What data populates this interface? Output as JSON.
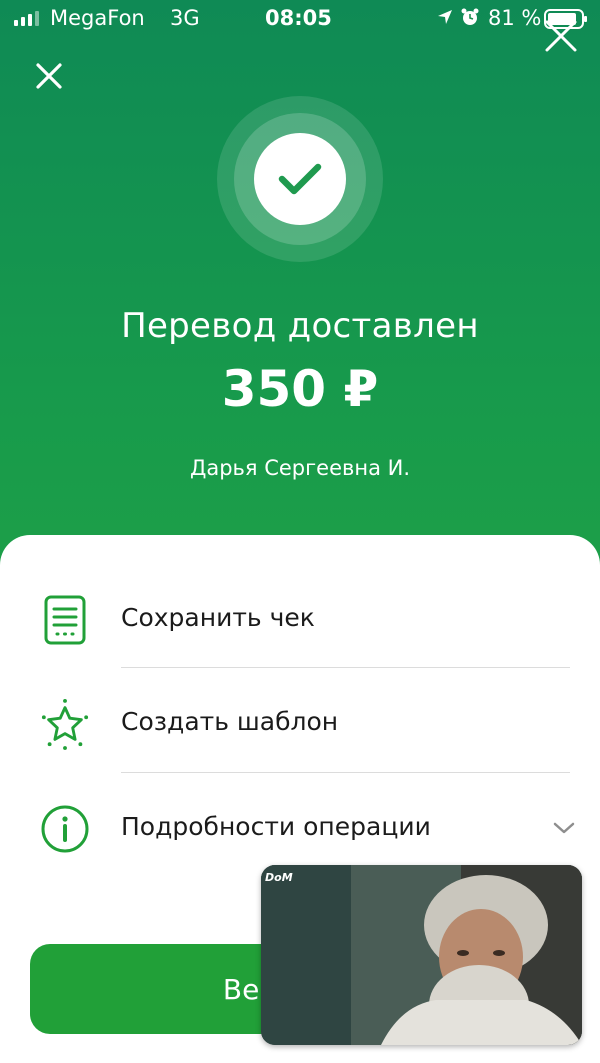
{
  "status_bar": {
    "carrier": "MegaFon",
    "network": "3G",
    "time": "08:05",
    "battery": "81 %"
  },
  "header": {
    "title": "Перевод доставлен",
    "amount": "350 ₽",
    "recipient": "Дарья Сергеевна И."
  },
  "actions": [
    {
      "label": "Сохранить чек",
      "icon": "receipt-icon"
    },
    {
      "label": "Создать шаблон",
      "icon": "star-icon"
    },
    {
      "label": "Подробности операции",
      "icon": "info-icon"
    }
  ],
  "return_button": {
    "label": "Вернуться"
  },
  "pip_video": {
    "watermark": "DoM"
  },
  "colors": {
    "brand_green": "#21a038",
    "header_top": "#0f8a55",
    "header_bottom": "#2aa742",
    "sheet": "#ffffff"
  }
}
